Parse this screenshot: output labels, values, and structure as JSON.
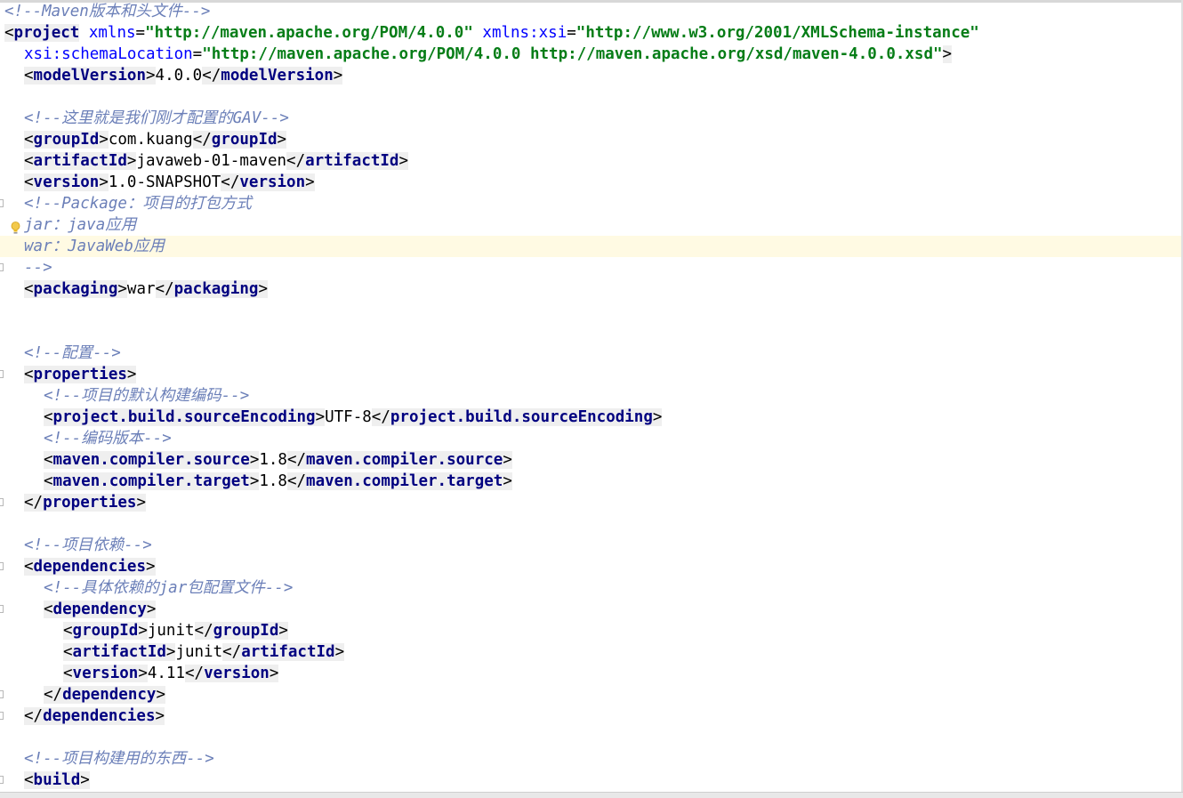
{
  "editor": {
    "lines": {
      "l1": "<!--Maven版本和头文件-->",
      "l2": {
        "tag": "project",
        "a1": "xmlns",
        "v1": "\"http://maven.apache.org/POM/4.0.0\"",
        "a2": "xmlns:xsi",
        "v2": "\"http://www.w3.org/2001/XMLSchema-instance\""
      },
      "l3": {
        "a": "xsi:schemaLocation",
        "v": "\"http://maven.apache.org/POM/4.0.0 http://maven.apache.org/xsd/maven-4.0.0.xsd\""
      },
      "l4": {
        "tag": "modelVersion",
        "text": "4.0.0"
      },
      "l6": "<!--这里就是我们刚才配置的GAV-->",
      "l7": {
        "tag": "groupId",
        "text": "com.kuang"
      },
      "l8": {
        "tag": "artifactId",
        "text": "javaweb-01-maven"
      },
      "l9": {
        "tag": "version",
        "text": "1.0-SNAPSHOT"
      },
      "l10": "<!--Package：项目的打包方式",
      "l11": "jar：java应用",
      "l12": "war：JavaWeb应用",
      "l13": "-->",
      "l14": {
        "tag": "packaging",
        "text": "war"
      },
      "l17": "<!--配置-->",
      "l18": {
        "tag": "properties"
      },
      "l19": "<!--项目的默认构建编码-->",
      "l20": {
        "tag": "project.build.sourceEncoding",
        "text": "UTF-8"
      },
      "l21": "<!--编码版本-->",
      "l22": {
        "tag": "maven.compiler.source",
        "text": "1.8"
      },
      "l23": {
        "tag": "maven.compiler.target",
        "text": "1.8"
      },
      "l24": {
        "tag": "properties"
      },
      "l26": "<!--项目依赖-->",
      "l27": {
        "tag": "dependencies"
      },
      "l28": "<!--具体依赖的jar包配置文件-->",
      "l29": {
        "tag": "dependency"
      },
      "l30": {
        "tag": "groupId",
        "text": "junit"
      },
      "l31": {
        "tag": "artifactId",
        "text": "junit"
      },
      "l32": {
        "tag": "version",
        "text": "4.11"
      },
      "l33": {
        "tag": "dependency"
      },
      "l34": {
        "tag": "dependencies"
      },
      "l36": "<!--项目构建用的东西-->",
      "l37": {
        "tag": "build"
      }
    }
  },
  "colors": {
    "tag": "#000080",
    "attribute": "#0000ff",
    "attribute_value": "#067d17",
    "comment": "#6b7fb8",
    "caret_line": "#fffae3",
    "tag_background": "#efefef"
  },
  "icons": {
    "gutter": "intention-bulb-icon"
  }
}
